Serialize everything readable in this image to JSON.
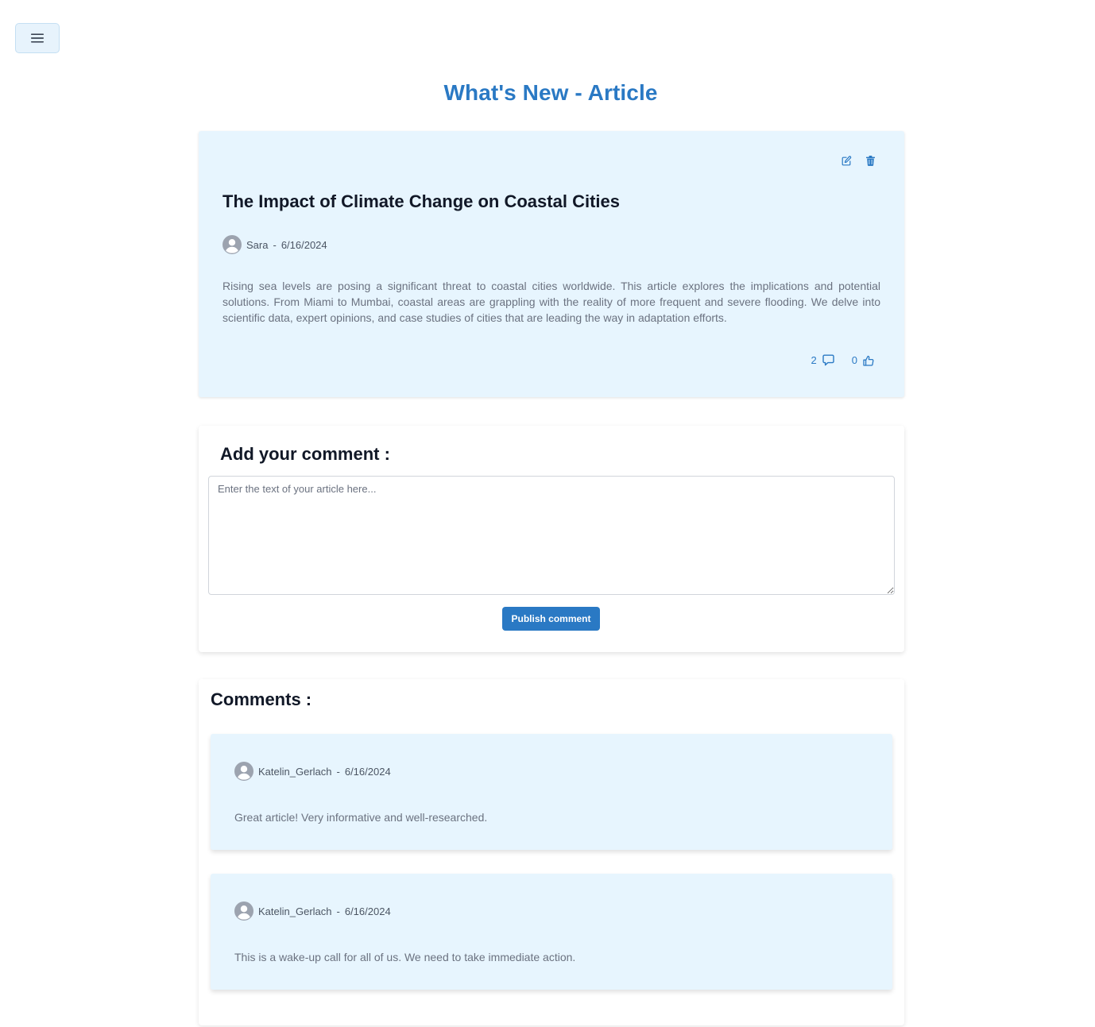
{
  "header": {
    "page_title": "What's New - Article",
    "menu_icon": "hamburger-menu-icon"
  },
  "article": {
    "title": "The Impact of Climate Change on Coastal Cities",
    "author": "Sara",
    "date": "6/16/2024",
    "body": "Rising sea levels are posing a significant threat to coastal cities worldwide. This article explores the implications and potential solutions. From Miami to Mumbai, coastal areas are grappling with the reality of more frequent and severe flooding. We delve into scientific data, expert opinions, and case studies of cities that are leading the way in adaptation efforts.",
    "comment_count": "2",
    "like_count": "0",
    "actions": {
      "edit_icon": "edit-icon",
      "delete_icon": "trash-icon"
    }
  },
  "comment_form": {
    "heading": "Add your comment :",
    "placeholder": "Enter the text of your article here...",
    "value": "",
    "submit_label": "Publish comment"
  },
  "comments": {
    "heading": "Comments :",
    "items": [
      {
        "author": "Katelin_Gerlach",
        "date": "6/16/2024",
        "text": "Great article! Very informative and well-researched."
      },
      {
        "author": "Katelin_Gerlach",
        "date": "6/16/2024",
        "text": "This is a wake-up call for all of us. We need to take immediate action."
      }
    ]
  },
  "colors": {
    "accent": "#2a79c4",
    "card_background": "#e7f5fe",
    "menu_background": "#e7f3fc",
    "heading_text": "#111827",
    "body_text": "#6b7280"
  },
  "meta_separator": "-"
}
